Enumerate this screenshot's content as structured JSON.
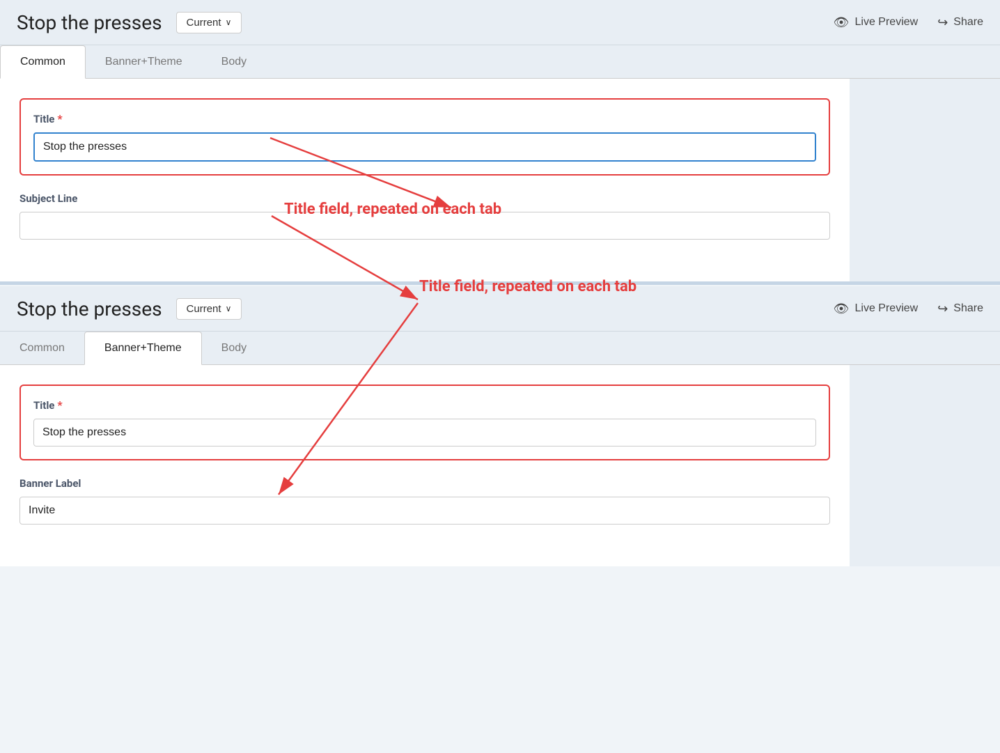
{
  "top_panel": {
    "header": {
      "title": "Stop the presses",
      "version_dropdown": "Current",
      "version_dropdown_label": "Current ∨",
      "live_preview_label": "Live Preview",
      "share_label": "Share"
    },
    "tabs": [
      {
        "id": "common",
        "label": "Common",
        "active": true
      },
      {
        "id": "banner-theme",
        "label": "Banner+Theme",
        "active": false
      },
      {
        "id": "body",
        "label": "Body",
        "active": false
      }
    ],
    "form": {
      "title_label": "Title",
      "title_required": "*",
      "title_value": "Stop the presses",
      "title_placeholder": "",
      "subject_line_label": "Subject Line",
      "subject_line_value": "",
      "subject_line_placeholder": ""
    }
  },
  "bottom_panel": {
    "header": {
      "title": "Stop the presses",
      "version_dropdown_label": "Current ∨",
      "live_preview_label": "Live Preview",
      "share_label": "Share"
    },
    "tabs": [
      {
        "id": "common",
        "label": "Common",
        "active": false
      },
      {
        "id": "banner-theme",
        "label": "Banner+Theme",
        "active": true
      },
      {
        "id": "body",
        "label": "Body",
        "active": false
      }
    ],
    "form": {
      "title_label": "Title",
      "title_required": "*",
      "title_value": "Stop the presses",
      "banner_label_label": "Banner Label",
      "banner_label_value": "Invite"
    }
  },
  "annotation": {
    "text": "Title field, repeated on each tab"
  }
}
